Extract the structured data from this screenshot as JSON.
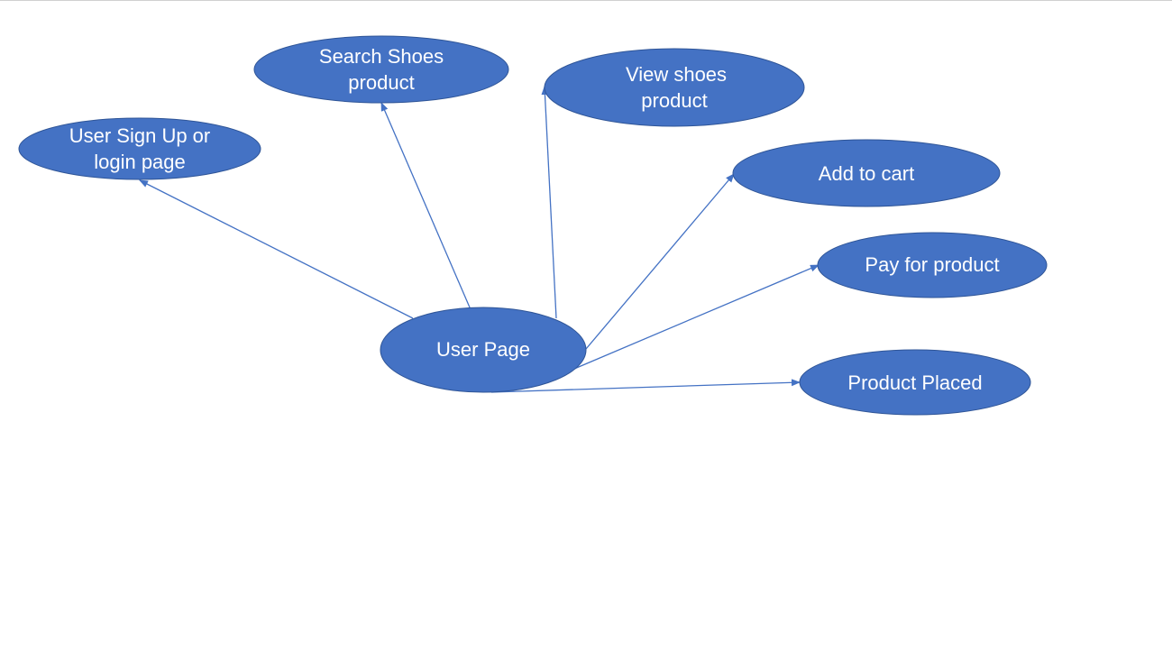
{
  "colors": {
    "node_fill": "#4472C4",
    "node_stroke": "#2F5597",
    "arrow": "#4472C4",
    "background": "#FFFFFF"
  },
  "nodes": {
    "user_page": {
      "lines": [
        "User Page"
      ]
    },
    "signup": {
      "lines": [
        "User Sign Up or",
        "login page"
      ]
    },
    "search": {
      "lines": [
        "Search Shoes",
        "product"
      ]
    },
    "view": {
      "lines": [
        "View shoes",
        "product"
      ]
    },
    "cart": {
      "lines": [
        "Add to cart"
      ]
    },
    "pay": {
      "lines": [
        "Pay for product"
      ]
    },
    "placed": {
      "lines": [
        "Product Placed"
      ]
    }
  },
  "edges": [
    {
      "from": "user_page",
      "to": "signup"
    },
    {
      "from": "user_page",
      "to": "search"
    },
    {
      "from": "user_page",
      "to": "view"
    },
    {
      "from": "user_page",
      "to": "cart"
    },
    {
      "from": "user_page",
      "to": "pay"
    },
    {
      "from": "user_page",
      "to": "placed"
    }
  ]
}
